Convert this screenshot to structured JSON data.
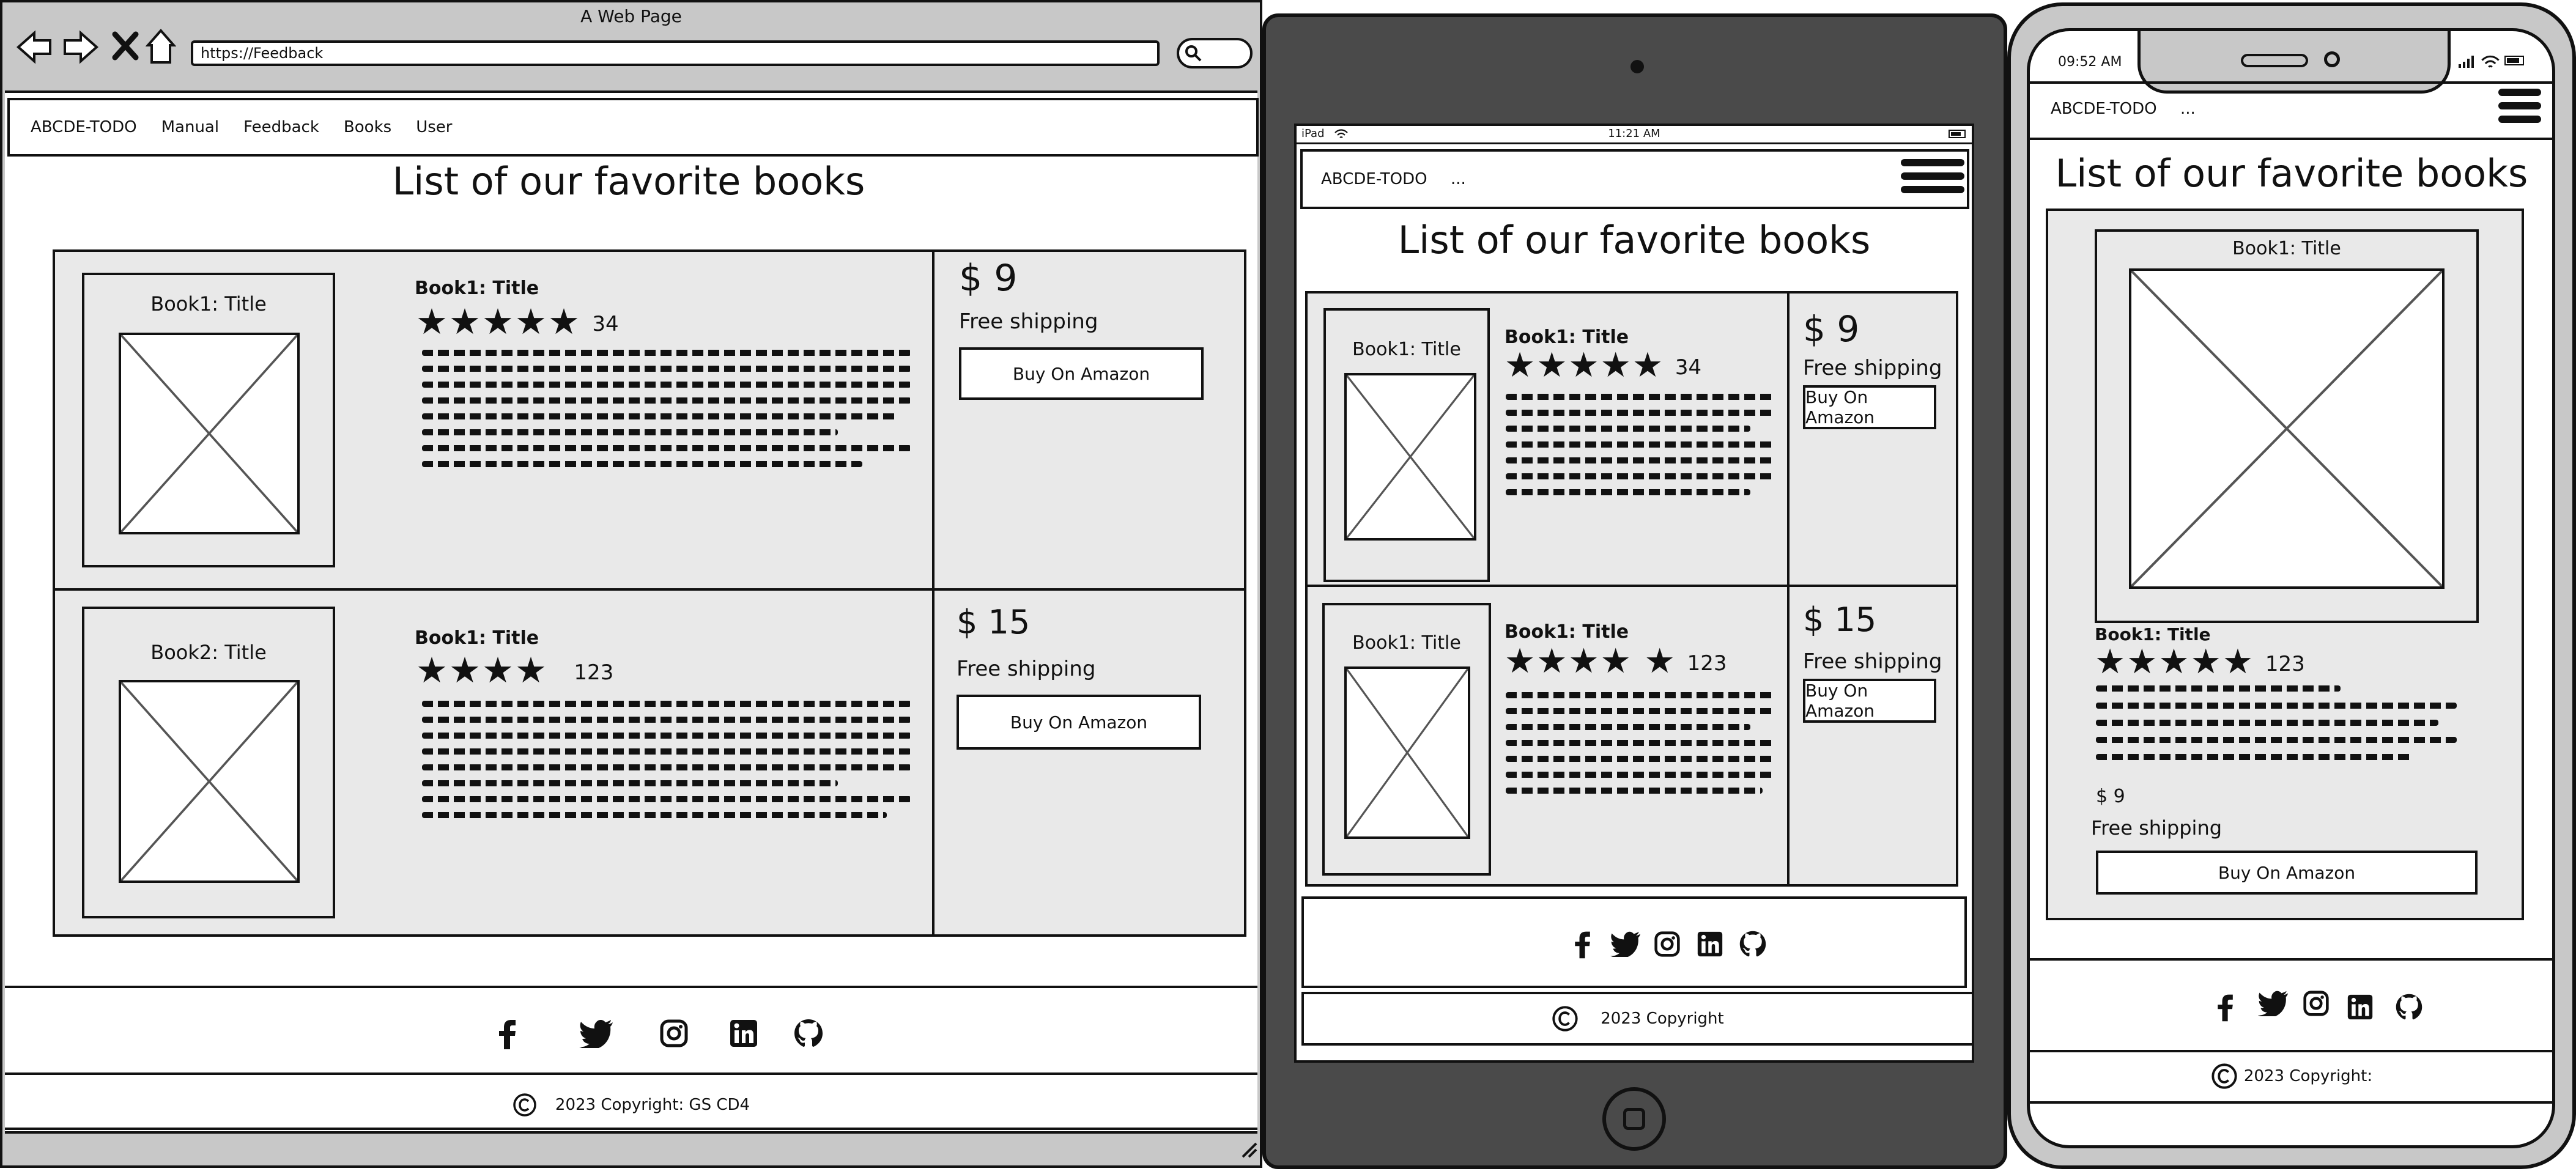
{
  "desktop": {
    "window_title": "A Web Page",
    "url": "https://Feedback",
    "nav": {
      "brand": "ABCDE-TODO",
      "items": [
        "Manual",
        "Feedback",
        "Books",
        "User"
      ]
    },
    "page_title": "List of our favorite books",
    "books": [
      {
        "image_title": "Book1: Title",
        "title": "Book1: Title",
        "stars": 5,
        "reviews": "34",
        "price": "$ 9",
        "shipping": "Free shipping",
        "buy_label": "Buy On Amazon"
      },
      {
        "image_title": "Book2: Title",
        "title": "Book1: Title",
        "stars": 4,
        "reviews": "123",
        "price": "$ 15",
        "shipping": "Free shipping",
        "buy_label": "Buy On Amazon"
      }
    ],
    "footer": {
      "copyright": "2023 Copyright: GS CD4"
    }
  },
  "tablet": {
    "status": {
      "device": "iPad",
      "time": "11:21 AM"
    },
    "nav": {
      "brand": "ABCDE-TODO",
      "more": "..."
    },
    "page_title": "List of our favorite books",
    "books": [
      {
        "image_title": "Book1: Title",
        "title": "Book1: Title",
        "stars": 5,
        "reviews": "34",
        "price": "$ 9",
        "shipping": "Free shipping",
        "buy_label": "Buy On Amazon"
      },
      {
        "image_title": "Book1: Title",
        "title": "Book1: Title",
        "stars": 5,
        "reviews": "123",
        "price": "$ 15",
        "shipping": "Free shipping",
        "buy_label": "Buy On Amazon"
      }
    ],
    "footer": {
      "copyright": "2023 Copyright"
    }
  },
  "phone": {
    "status": {
      "time": "09:52 AM"
    },
    "nav": {
      "brand": "ABCDE-TODO",
      "more": "..."
    },
    "page_title": "List of our favorite books",
    "book": {
      "image_title": "Book1: Title",
      "title": "Book1: Title",
      "stars": 5,
      "reviews": "123",
      "price": "$ 9",
      "shipping": "Free shipping",
      "buy_label": "Buy On Amazon"
    },
    "footer": {
      "copyright": "2023 Copyright:"
    }
  },
  "icons": [
    "facebook-icon",
    "twitter-icon",
    "instagram-icon",
    "linkedin-icon",
    "github-icon"
  ],
  "colors": {
    "outline": "#111111",
    "panel": "#e9e9e9",
    "device_dark": "#4a4a4a",
    "browser_chrome": "#c8c8c8"
  }
}
